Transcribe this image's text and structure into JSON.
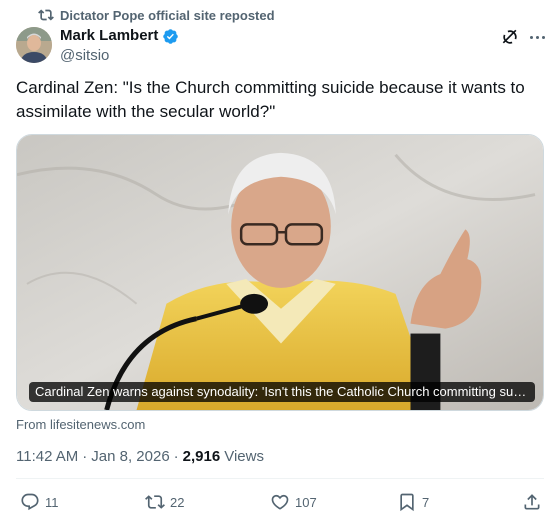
{
  "repost": {
    "text": "Dictator Pope official site reposted",
    "icon": "repost-icon"
  },
  "author": {
    "name": "Mark Lambert",
    "handle": "@sitsio",
    "verified": true
  },
  "tweet": {
    "text": "Cardinal Zen: \"Is the Church committing suicide because it wants to assimilate with the secular world?\""
  },
  "card": {
    "caption": "Cardinal Zen warns against synodality: 'Isn't this the Catholic Church committing suici…",
    "source": "From lifesitenews.com"
  },
  "meta": {
    "time": "11:42 AM",
    "date": "Jan 8, 2026",
    "separator": "·",
    "views_count": "2,916",
    "views_label": "Views"
  },
  "actions": {
    "replies": "11",
    "reposts": "22",
    "likes": "107",
    "bookmarks": "7"
  },
  "colors": {
    "accent": "#1d9bf0",
    "secondary_text": "#536471",
    "primary_text": "#0f1419"
  }
}
